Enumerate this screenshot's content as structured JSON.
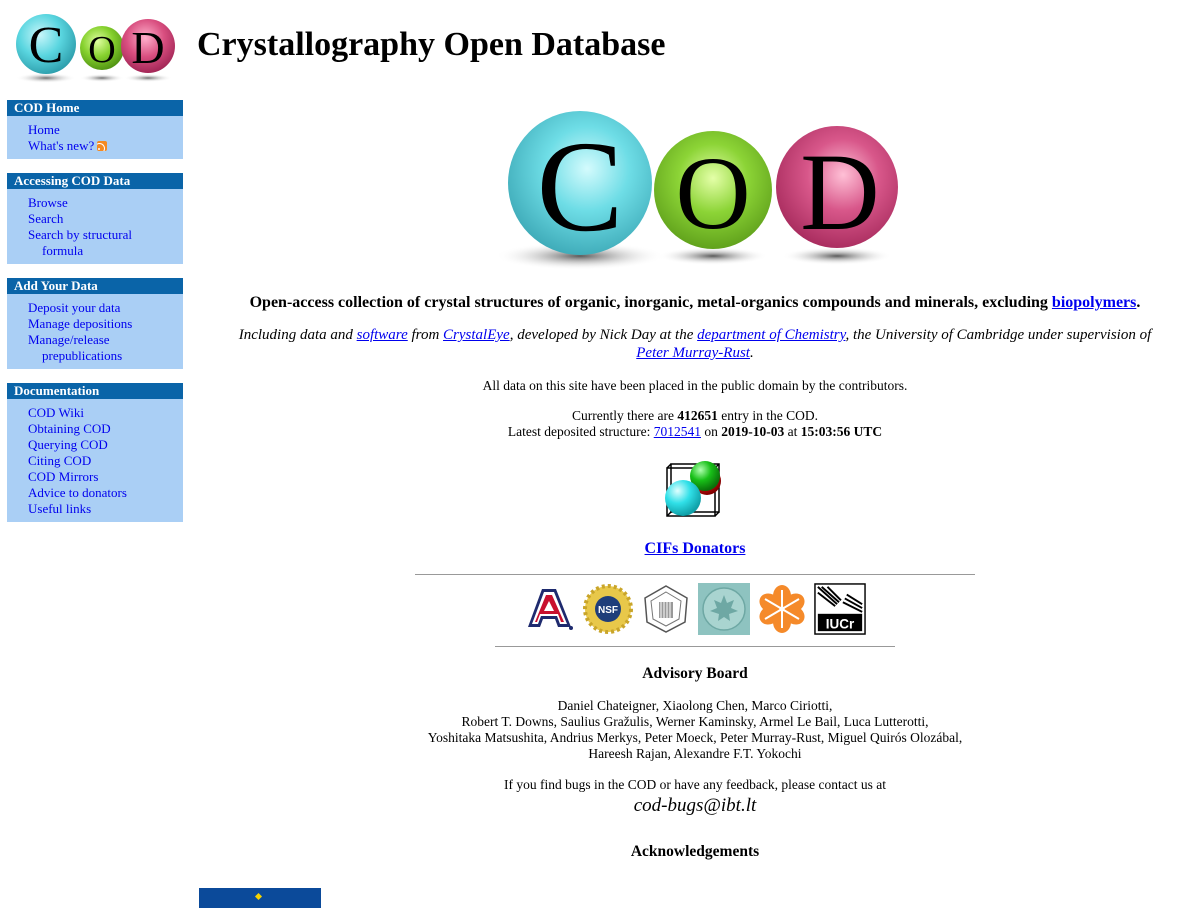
{
  "header": {
    "logo_letters": [
      "C",
      "O",
      "D"
    ],
    "title": "Crystallography Open Database"
  },
  "sidebar": {
    "sections": [
      {
        "title": "COD Home",
        "items": [
          {
            "label": "Home"
          },
          {
            "label": "What's new?",
            "icon": "rss-icon"
          }
        ]
      },
      {
        "title": "Accessing COD Data",
        "items": [
          {
            "label": "Browse"
          },
          {
            "label": "Search"
          },
          {
            "label": "Search by structural",
            "continuation": "formula"
          }
        ]
      },
      {
        "title": "Add Your Data",
        "items": [
          {
            "label": "Deposit your data"
          },
          {
            "label": "Manage depositions"
          },
          {
            "label": "Manage/release",
            "continuation": "prepublications"
          }
        ]
      },
      {
        "title": "Documentation",
        "items": [
          {
            "label": "COD Wiki"
          },
          {
            "label": "Obtaining COD"
          },
          {
            "label": "Querying COD"
          },
          {
            "label": "Citing COD"
          },
          {
            "label": "COD Mirrors"
          },
          {
            "label": "Advice to donators"
          },
          {
            "label": "Useful links"
          }
        ]
      }
    ]
  },
  "main": {
    "logo_letters": [
      "C",
      "O",
      "D"
    ],
    "intro_text": "Open-access collection of crystal structures of organic, inorganic, metal-organics compounds and minerals, excluding ",
    "intro_link": "biopolymers",
    "intro_end": ".",
    "credits": {
      "t1": "Including data and ",
      "link_software": "software",
      "t2": " from ",
      "link_crystaleye": "CrystalEye",
      "t3": ", developed by Nick Day at the ",
      "link_dept": "department of Chemistry",
      "t4": ", the University of Cambridge under supervision of ",
      "link_pmr": "Peter Murray-Rust",
      "t5": "."
    },
    "public_domain": "All data on this site have been placed in the public domain by the contributors.",
    "stats": {
      "t1": "Currently there are ",
      "entry_count": "412651",
      "t2": " entry in the COD.",
      "t3": "Latest deposited structure: ",
      "latest_id": "7012541",
      "t4": " on ",
      "date": "2019-10-03",
      "t5": " at ",
      "time": "15:03:56 UTC"
    },
    "donators_link": "CIFs Donators",
    "sponsors": [
      {
        "name": "University of Arizona",
        "icon": "arizona-logo"
      },
      {
        "name": "NSF",
        "icon": "nsf-logo"
      },
      {
        "name": "Mineralogical Society of America",
        "icon": "msa-logo"
      },
      {
        "name": "Mineralogical Association of Canada",
        "icon": "mac-logo"
      },
      {
        "name": "Orange snowflake society",
        "icon": "snowflake-logo"
      },
      {
        "name": "IUCr",
        "icon": "iucr-logo",
        "text": "IUCr"
      }
    ],
    "advisory_title": "Advisory Board",
    "advisory_lines": [
      "Daniel Chateigner, Xiaolong Chen, Marco Ciriotti,",
      "Robert T. Downs, Saulius Gražulis, Werner Kaminsky, Armel Le Bail, Luca Lutterotti,",
      "Yoshitaka Matsushita, Andrius Merkys, Peter Moeck, Peter Murray-Rust, Miguel Quirós Olozábal,",
      "Hareesh Rajan, Alexandre F.T. Yokochi"
    ],
    "bugs_text": "If you find bugs in the COD or have any feedback, please contact us at",
    "email": "cod-bugs@ibt.lt",
    "ack_title": "Acknowledgements"
  },
  "colors": {
    "sidebar_header": "#0a64a8",
    "sidebar_body": "#aacff5",
    "link": "#0000ee",
    "sphere_cyan": "#5ad6e0",
    "sphere_green": "#86d12e",
    "sphere_pink": "#d94f80"
  }
}
